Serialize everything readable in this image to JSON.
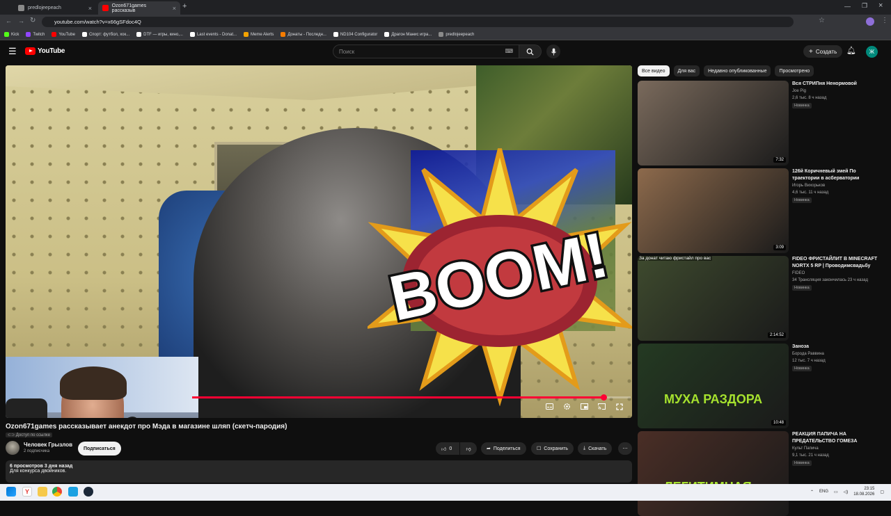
{
  "browser": {
    "tabs": [
      {
        "title": "predlojeepeach",
        "color": "#8a8a8a"
      },
      {
        "title": "Ozon671games рассказыв",
        "color": "#ff0000"
      }
    ],
    "url": "youtube.com/watch?v=x66gSFdoc4Q",
    "bookmarks": [
      {
        "label": "Kick",
        "color": "#53fc18"
      },
      {
        "label": "Twitch",
        "color": "#9146ff"
      },
      {
        "label": "YouTube",
        "color": "#ff0000"
      },
      {
        "label": "Спорт: футбол, хок...",
        "color": "#ffffff"
      },
      {
        "label": "DTF — игры, кино,...",
        "color": "#ffffff"
      },
      {
        "label": "Last events - Donat...",
        "color": "#ffffff"
      },
      {
        "label": "Meme Alerts",
        "color": "#f4a300"
      },
      {
        "label": "Донаты - Последн...",
        "color": "#f57c00"
      },
      {
        "label": "ND104 Configurator",
        "color": "#ffffff"
      },
      {
        "label": "Драгон Манис игра...",
        "color": "#ffffff"
      },
      {
        "label": "predlojeepeach",
        "color": "#8a8a8a"
      }
    ]
  },
  "masthead": {
    "logo": "YouTube",
    "search_placeholder": "Поиск",
    "create_label": "Создать",
    "avatar_letter": "Ж"
  },
  "player": {
    "overlay_text": "BOOM!",
    "progress": 0.938
  },
  "video": {
    "title": "Ozon671games рассказывает анекдот про Мэда в магазине шляп (скетч-пародия)",
    "access_label": "Доступ по ссылке",
    "channel": "Человек Грызлов",
    "subscribers": "2 подписчика",
    "subscribe_label": "Подписаться",
    "likes": "0",
    "share_label": "Поделиться",
    "save_label": "Сохранить",
    "download_label": "Скачать",
    "views_date": "6 просмотров  3 дня назад",
    "description": "Для конкурса двойников."
  },
  "filters": [
    "Все видео",
    "Для вас",
    "Недавно опубликованные",
    "Просмотрено"
  ],
  "recommendations": [
    {
      "title": "Вся СТРИПня Ненормовой",
      "channel": "Joe Pig",
      "meta": "2,6 тыс.  8 ч назад",
      "badge": "Новинка",
      "duration": "7:32",
      "thumb_color": "#7a6a5c",
      "thumb_text": ""
    },
    {
      "title": "126й Коричневый змей По траектории в асберватории",
      "channel": "Игорь Вихорьков",
      "meta": "4,6 тыс.  11 ч назад",
      "badge": "Новинка",
      "duration": "3:09",
      "thumb_color": "#8d6a4c",
      "thumb_text": ""
    },
    {
      "title": "FIDEO ФРИСТАЙЛИТ В MINECRAFT NORTX 5 RP | Проводимсвадьбу",
      "channel": "FIDEO",
      "meta": "34  Трансляция закончилась 23 ч назад",
      "badge": "Новинка",
      "duration": "2:14:52",
      "thumb_color": "#3e4a2e",
      "thumb_text": "За донат читаю фристайл про вас"
    },
    {
      "title": "Заноза",
      "channel": "Борода Раввина",
      "meta": "12 тыс.  7 ч назад",
      "badge": "Новинка",
      "duration": "10:48",
      "thumb_color": "#243a22",
      "thumb_text": "МУХА РАЗДОРА"
    },
    {
      "title": "РЕАКЦИЯ ПАПИЧА НА ПРЕДАТЕЛЬСТВО ГОМЕЗА",
      "channel": "Культ Папича",
      "meta": "9,1 тыс.  21 ч назад",
      "badge": "Новинка",
      "duration": "",
      "thumb_color": "#4a2e26",
      "thumb_text": "ЛЕГИТИМНАЯ"
    }
  ],
  "taskbar": {
    "lang": "ENG",
    "time": "23:15",
    "date": "18.08.2026"
  }
}
